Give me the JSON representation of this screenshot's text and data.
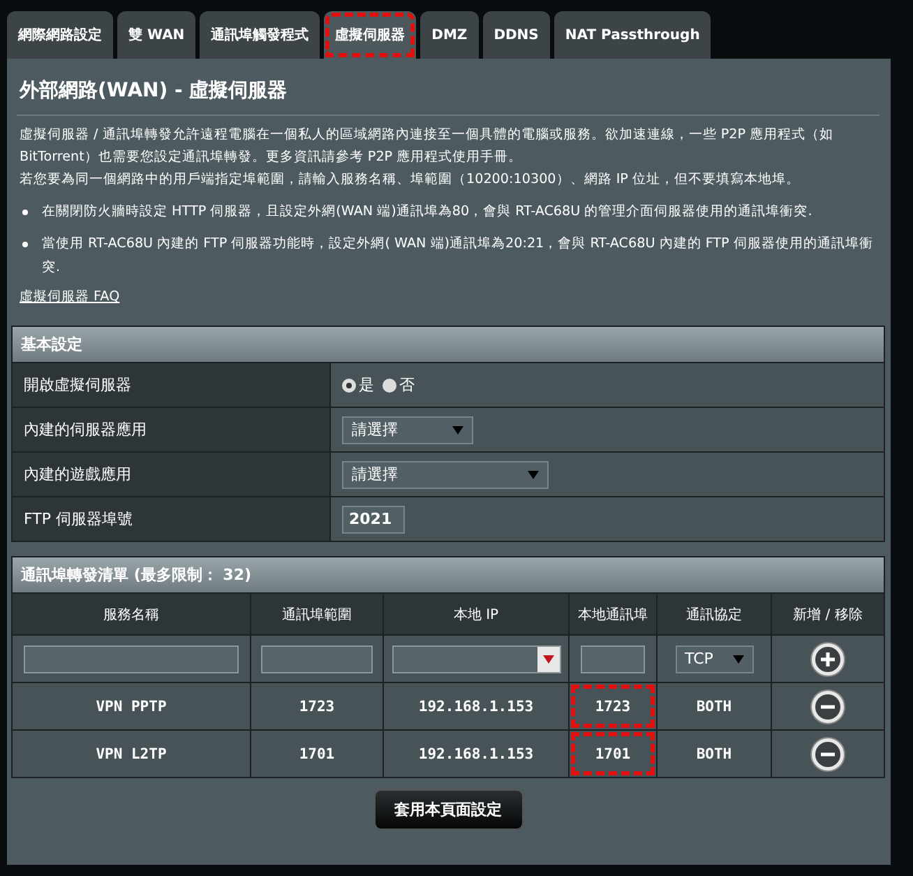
{
  "tabs": [
    {
      "label": "網際網路設定",
      "selected": false,
      "annotated": false
    },
    {
      "label": "雙 WAN",
      "selected": false,
      "annotated": false
    },
    {
      "label": "通訊埠觸發程式",
      "selected": false,
      "annotated": false
    },
    {
      "label": "虛擬伺服器",
      "selected": true,
      "annotated": true
    },
    {
      "label": "DMZ",
      "selected": false,
      "annotated": false
    },
    {
      "label": "DDNS",
      "selected": false,
      "annotated": false
    },
    {
      "label": "NAT Passthrough",
      "selected": false,
      "annotated": false
    }
  ],
  "page_title": "外部網路(WAN) - 虛擬伺服器",
  "intro": [
    "虛擬伺服器 / 通訊埠轉發允許遠程電腦在一個私人的區域網路內連接至一個具體的電腦或服務。欲加速連線，一些 P2P 應用程式（如 BitTorrent）也需要您設定通訊埠轉發。更多資訊請參考 P2P 應用程式使用手冊。",
    "若您要為同一個網路中的用戶端指定埠範圍，請輸入服務名稱、埠範圍（10200:10300）、網路 IP 位址，但不要填寫本地埠。"
  ],
  "notes": [
    "在關閉防火牆時設定 HTTP 伺服器，且設定外網(WAN 端)通訊埠為80，會與 RT-AC68U 的管理介面伺服器使用的通訊埠衝突.",
    "當使用 RT-AC68U 內建的 FTP 伺服器功能時，設定外網( WAN 端)通訊埠為20:21，會與 RT-AC68U 內建的 FTP 伺服器使用的通訊埠衝突."
  ],
  "faq_link": "虛擬伺服器  FAQ",
  "basic_settings": {
    "title": "基本設定",
    "rows": [
      {
        "kind": "radio",
        "label": "開啟虛擬伺服器",
        "options": [
          {
            "label": "是",
            "selected": true
          },
          {
            "label": "否",
            "selected": false
          }
        ]
      },
      {
        "kind": "select",
        "label": "內建的伺服器應用",
        "value": "請選擇",
        "wide": false
      },
      {
        "kind": "select",
        "label": "內建的遊戲應用",
        "value": "請選擇",
        "wide": true
      },
      {
        "kind": "input",
        "label": "FTP 伺服器埠號",
        "value": "2021"
      }
    ]
  },
  "forward_list": {
    "title": "通訊埠轉發清單 (最多限制： 32)",
    "columns": [
      "服務名稱",
      "通訊埠範圍",
      "本地 IP",
      "本地通訊埠",
      "通訊協定",
      "新增 / 移除"
    ],
    "new_row": {
      "protocol": "TCP"
    },
    "rows": [
      {
        "name": "VPN PPTP",
        "port_range": "1723",
        "local_ip": "192.168.1.153",
        "local_port": "1723",
        "protocol": "BOTH",
        "port_annotated": true
      },
      {
        "name": "VPN L2TP",
        "port_range": "1701",
        "local_ip": "192.168.1.153",
        "local_port": "1701",
        "protocol": "BOTH",
        "port_annotated": true
      }
    ]
  },
  "apply_button": "套用本頁面設定"
}
